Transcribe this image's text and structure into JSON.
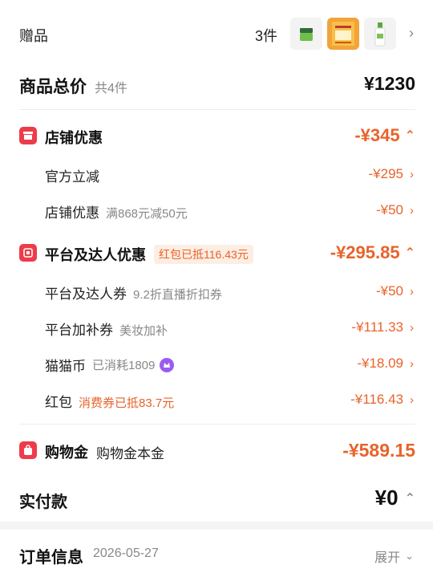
{
  "gifts": {
    "label": "赠品",
    "count": "3件",
    "thumbs": [
      "green-jar-icon",
      "orange-box-icon",
      "serum-bottle-icon"
    ]
  },
  "total": {
    "title": "商品总价",
    "sub": "共4件",
    "price": "¥1230"
  },
  "store": {
    "title": "店铺优惠",
    "amount": "-¥345",
    "items": [
      {
        "label": "官方立减",
        "note": "",
        "amount": "-¥295"
      },
      {
        "label": "店铺优惠",
        "note": "满868元减50元",
        "amount": "-¥50"
      }
    ]
  },
  "platform": {
    "title": "平台及达人优惠",
    "badge": "红包已抵116.43元",
    "amount": "-¥295.85",
    "items": [
      {
        "label": "平台及达人券",
        "note": "9.2折直播折扣券",
        "amount": "-¥50"
      },
      {
        "label": "平台加补券",
        "note": "美妆加补",
        "amount": "-¥111.33"
      },
      {
        "label": "猫猫币",
        "note": "已消耗1809",
        "amount": "-¥18.09"
      },
      {
        "label": "红包",
        "note": "消费券已抵83.7元",
        "amount": "-¥116.43"
      }
    ]
  },
  "shopping_gold": {
    "title": "购物金",
    "note": "购物金本金",
    "amount": "-¥589.15"
  },
  "paid": {
    "title": "实付款",
    "amount": "¥0"
  },
  "order": {
    "title": "订单信息",
    "date": "2026-05-27",
    "expand": "展开"
  },
  "colors": {
    "accent": "#e8632b",
    "icon_red": "#ee3b4a",
    "coin_purple": "#9a5cf0"
  }
}
